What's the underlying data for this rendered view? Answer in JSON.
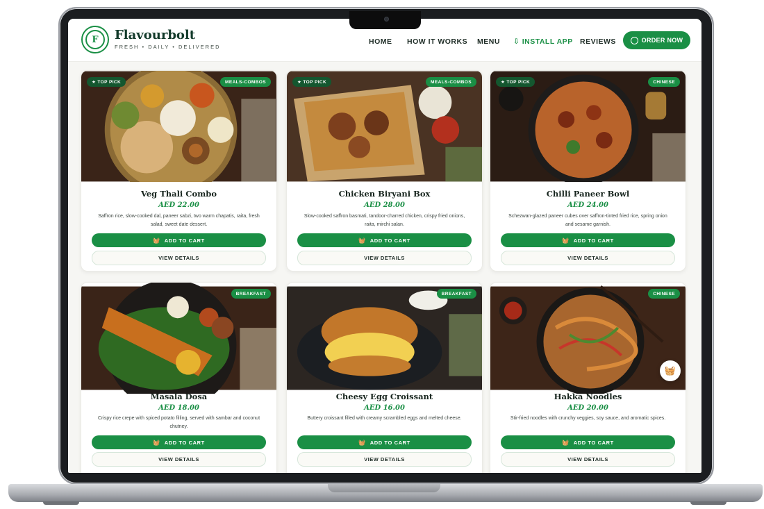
{
  "header": {
    "brand": "Flavourbolt",
    "tagline": "FRESH • DAILY • DELIVERED",
    "logo_letter": "F",
    "nav": [
      "HOME",
      "HOW IT WORKS",
      "MENU",
      "⇩ INSTALL APP",
      "REVIEWS"
    ],
    "order_now": "ORDER NOW"
  },
  "colors": {
    "accent": "#1a8f45",
    "dark_green": "#14572f",
    "text": "#17251e"
  },
  "cards": [
    {
      "title": "Veg Thali Combo",
      "price": "AED 22.00",
      "desc": "Saffron rice, slow-cooked dal, paneer sabzi, two warm chapatis, raita, fresh salad, sweet date dessert.",
      "top_pick": "★ TOP PICK",
      "category": "MEALS-COMBOS",
      "add": "ADD TO CART",
      "view": "VIEW DETAILS"
    },
    {
      "title": "Chicken Biryani Box",
      "price": "AED 28.00",
      "desc": "Slow-cooked saffron basmati, tandoor-charred chicken, crispy fried onions, raita, mirchi salan.",
      "top_pick": "★ TOP PICK",
      "category": "MEALS-COMBOS",
      "add": "ADD TO CART",
      "view": "VIEW DETAILS"
    },
    {
      "title": "Chilli Paneer Bowl",
      "price": "AED 24.00",
      "desc": "Schezwan-glazed paneer cubes over saffron-tinted fried rice, spring onion and sesame garnish.",
      "top_pick": "★ TOP PICK",
      "category": "CHINESE",
      "add": "ADD TO CART",
      "view": "VIEW DETAILS"
    },
    {
      "title": "Masala Dosa",
      "price": "AED 18.00",
      "desc": "Crispy rice crepe with spiced potato filling, served with sambar and coconut chutney.",
      "top_pick": "",
      "category": "BREAKFAST",
      "add": "ADD TO CART",
      "view": "VIEW DETAILS"
    },
    {
      "title": "Cheesy Egg Croissant",
      "price": "AED 16.00",
      "desc": "Buttery croissant filled with creamy scrambled eggs and melted cheese.",
      "top_pick": "",
      "category": "BREAKFAST",
      "add": "ADD TO CART",
      "view": "VIEW DETAILS"
    },
    {
      "title": "Hakka Noodles",
      "price": "AED 20.00",
      "desc": "Stir-fried noodles with crunchy veggies, soy sauce, and aromatic spices.",
      "top_pick": "",
      "category": "CHINESE",
      "add": "ADD TO CART",
      "view": "VIEW DETAILS"
    }
  ]
}
